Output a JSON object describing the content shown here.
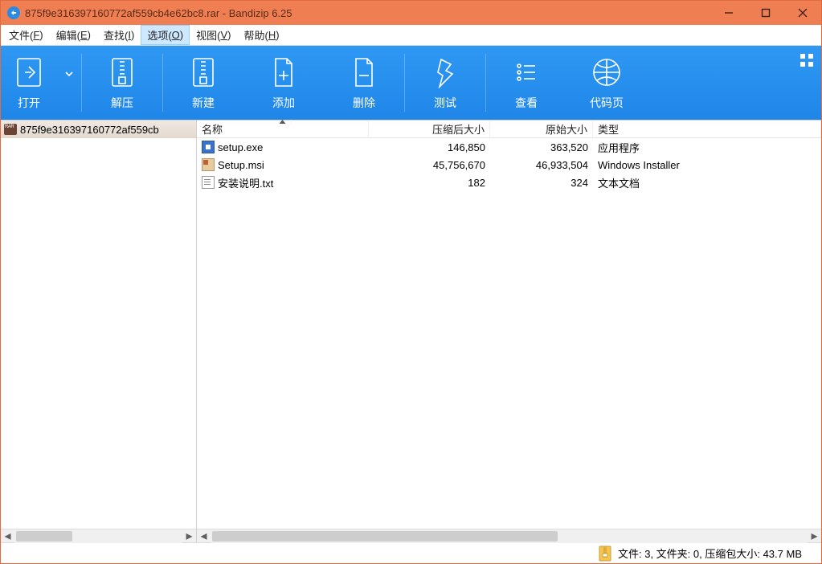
{
  "title": "875f9e316397160772af559cb4e62bc8.rar - Bandizip 6.25",
  "menu": [
    {
      "pre": "文件(",
      "hot": "F",
      "post": ")"
    },
    {
      "pre": "编辑(",
      "hot": "E",
      "post": ")"
    },
    {
      "pre": "查找(",
      "hot": "I",
      "post": ")"
    },
    {
      "pre": "选项(",
      "hot": "O",
      "post": ")",
      "active": true
    },
    {
      "pre": "视图(",
      "hot": "V",
      "post": ")"
    },
    {
      "pre": "帮助(",
      "hot": "H",
      "post": ")"
    }
  ],
  "toolbar": {
    "open": "打开",
    "extract": "解压",
    "new": "新建",
    "add": "添加",
    "delete": "删除",
    "test": "测试",
    "view": "查看",
    "codepage": "代码页"
  },
  "side": {
    "root_label": "875f9e316397160772af559cb"
  },
  "columns": {
    "name": "名称",
    "compressed": "压缩后大小",
    "original": "原始大小",
    "type": "类型"
  },
  "files": [
    {
      "icon": "exe",
      "name": "setup.exe",
      "csize": "146,850",
      "osize": "363,520",
      "type": "应用程序"
    },
    {
      "icon": "msi",
      "name": "Setup.msi",
      "csize": "45,756,670",
      "osize": "46,933,504",
      "type": "Windows Installer"
    },
    {
      "icon": "txt",
      "name": "安装说明.txt",
      "csize": "182",
      "osize": "324",
      "type": "文本文档"
    }
  ],
  "status": "文件: 3, 文件夹: 0, 压缩包大小: 43.7 MB"
}
